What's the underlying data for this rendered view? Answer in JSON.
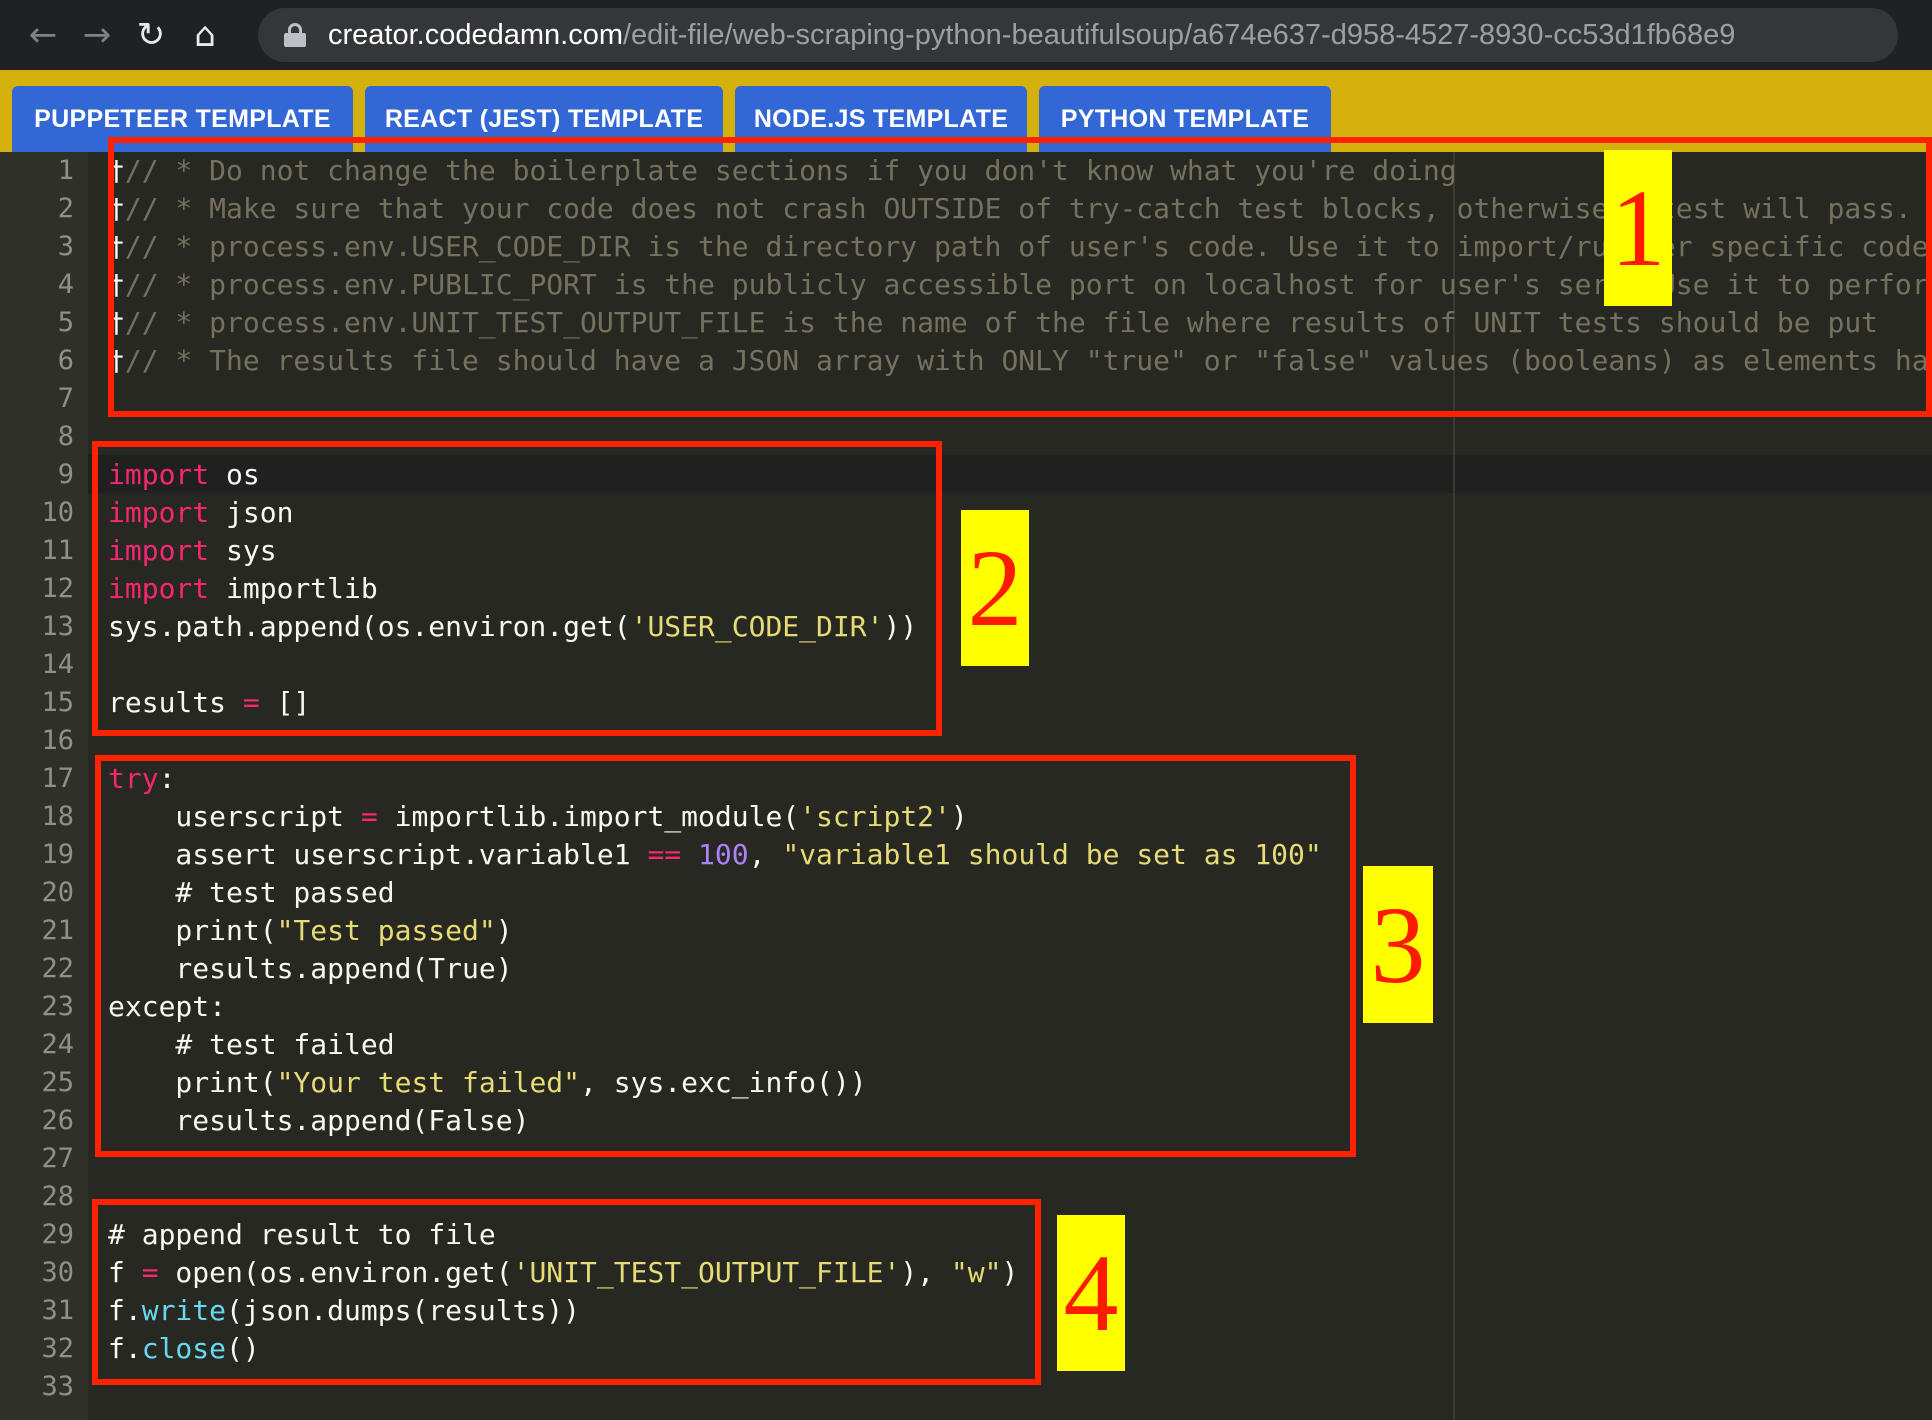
{
  "browser": {
    "back_icon": "←",
    "forward_icon": "→",
    "reload_icon": "↻",
    "home_icon": "⌂",
    "url_host": "creator.codedamn.com",
    "url_path": "/edit-file/web-scraping-python-beautifulsoup/a674e637-d958-4527-8930-cc53d1fb68e9"
  },
  "templates": [
    {
      "label": "PUPPETEER TEMPLATE"
    },
    {
      "label": "REACT (JEST) TEMPLATE"
    },
    {
      "label": "NODE.JS TEMPLATE"
    },
    {
      "label": "PYTHON TEMPLATE"
    }
  ],
  "editor": {
    "fold_mark": "†",
    "line_numbers": [
      "1",
      "2",
      "3",
      "4",
      "5",
      "6",
      "7",
      "8",
      "9",
      "10",
      "11",
      "12",
      "13",
      "14",
      "15",
      "16",
      "17",
      "18",
      "19",
      "20",
      "21",
      "22",
      "23",
      "24",
      "25",
      "26",
      "27",
      "28",
      "29",
      "30",
      "31",
      "32",
      "33"
    ],
    "comments": [
      "// * Do not change the boilerplate sections if you don't know what you're doing",
      "// * Make sure that your code does not crash OUTSIDE of try-catch test blocks, otherwise   test will pass.",
      "// * process.env.USER_CODE_DIR is the directory path of user's code. Use it to import/ru   er specific code",
      "// * process.env.PUBLIC_PORT is the publicly accessible port on localhost for user's ser   Use it to perform",
      "// * process.env.UNIT_TEST_OUTPUT_FILE is the name of the file where results of UNIT tests should be put",
      "// * The results file should have a JSON array with ONLY \"true\" or \"false\" values (booleans) as elements having"
    ],
    "tokens": {
      "import": "import",
      "mod_os": " os",
      "mod_json": " json",
      "mod_sys": " sys",
      "mod_importlib": " importlib",
      "l13_a": "sys.path.append(os.environ.get(",
      "l13_str": "'USER_CODE_DIR'",
      "l13_b": "))",
      "l15_a": "results ",
      "eq": "=",
      "l15_b": " []",
      "try": "try",
      "colon": ":",
      "l18_a": "    userscript ",
      "l18_b": " importlib.import_module(",
      "l18_str": "'script2'",
      "l18_c": ")",
      "l19_a": "    assert userscript.variable1 ",
      "eqeq": "==",
      "l19_num": "100",
      "l19_b": ", ",
      "l19_str": "\"variable1 should be set as 100\"",
      "l20": "    # test passed",
      "l21_a": "    print(",
      "l21_str": "\"Test passed\"",
      "l21_b": ")",
      "l22": "    results.append(True)",
      "l23": "except:",
      "l24": "    # test failed",
      "l25_a": "    print(",
      "l25_str": "\"Your test failed\"",
      "l25_b": ", sys.exc_info())",
      "l26": "    results.append(False)",
      "l29": "# append result to file",
      "l30_a": "f ",
      "l30_b": " open(os.environ.get(",
      "l30_str1": "'UNIT_TEST_OUTPUT_FILE'",
      "l30_c": "), ",
      "l30_str2": "\"w\"",
      "l30_d": ")",
      "f_dot": "f.",
      "write": "write",
      "l31_b": "(json.dumps(results))",
      "close": "close",
      "l32_b": "()"
    }
  },
  "annotations": [
    {
      "label": "1"
    },
    {
      "label": "2"
    },
    {
      "label": "3"
    },
    {
      "label": "4"
    }
  ],
  "colors": {
    "editor_bg": "#272822",
    "template_bar": "#d4b10c",
    "tab_blue": "#3367d6",
    "annotation_red": "#ff2200",
    "annotation_yellow": "#ffff00"
  }
}
